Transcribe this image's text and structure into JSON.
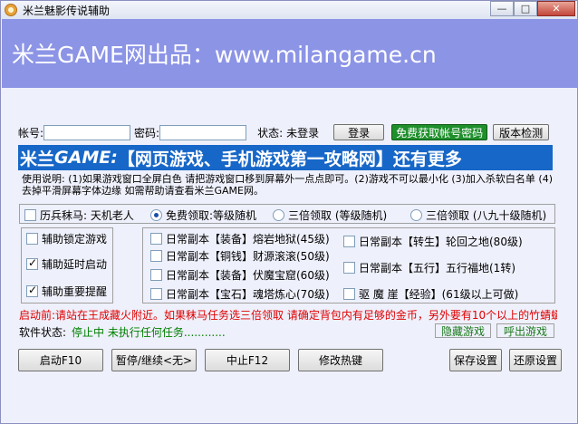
{
  "window": {
    "title": "米兰魅影传说辅助"
  },
  "title_buttons": {
    "minimize": "—",
    "maximize": "□",
    "close": "✕"
  },
  "banner": {
    "text": "米兰GAME网出品：www.milangame.cn"
  },
  "login": {
    "account_label": "帐号:",
    "account_value": "",
    "password_label": "密码:",
    "password_value": "",
    "status_label": "状态:",
    "status_value": "未登录",
    "login_button": "登录",
    "free_account_button": "免费获取帐号密码",
    "version_button": "版本检测"
  },
  "promo": {
    "prefix": "米兰",
    "game": "GAME:",
    "rest": "【网页游戏、手机游戏第一攻略网】还有更多"
  },
  "instructions": "使用说明: (1)如果游戏窗口全屏白色 请把游戏窗口移到屏幕外一点点即可。(2)游戏不可以最小化 (3)加入杀软白名单 (4)去掉平滑屏幕字体边缘 如需帮助请查看米兰GAME网。",
  "mode_options": [
    {
      "label": "历兵秣马: 天机老人",
      "type": "checkbox",
      "checked": false
    },
    {
      "label": "免费领取:等级随机",
      "type": "radio",
      "checked": true
    },
    {
      "label": "三倍领取 (等级随机)",
      "type": "radio",
      "checked": false
    },
    {
      "label": "三倍领取 (八九十级随机)",
      "type": "radio",
      "checked": false
    }
  ],
  "aux_options": [
    {
      "label": "辅助锁定游戏",
      "checked": false
    },
    {
      "label": "辅助延时启动",
      "checked": true
    },
    {
      "label": "辅助重要提醒",
      "checked": true
    }
  ],
  "daily_left": [
    {
      "label": "日常副本【装备】熔岩地狱(45级)",
      "checked": false
    },
    {
      "label": "日常副本【铜钱】财源滚滚(50级)",
      "checked": false
    },
    {
      "label": "日常副本【装备】伏魔宝窟(60级)",
      "checked": false
    },
    {
      "label": "日常副本【宝石】魂塔炼心(70级)",
      "checked": false
    }
  ],
  "daily_right": [
    {
      "label": "日常副本【转生】轮回之地(80级)",
      "checked": false
    },
    {
      "label": "日常副本【五行】五行福地(1转)",
      "checked": false
    },
    {
      "label": "驱 魔 崖【经验】(61级以上可做)",
      "checked": false
    }
  ],
  "notice": "启动前:请站在王成藏火附近。如果秣马任务选三倍领取 请确定背包内有足够的金币，另外要有10个以上的竹蜻蜓",
  "software_status": {
    "label": "软件状态:",
    "value": "停止中 未执行任何任务............"
  },
  "status_buttons": {
    "hide": "隐藏游戏",
    "show": "呼出游戏"
  },
  "bottom_buttons": {
    "start": "启动F10",
    "pause": "暂停/继续<无>",
    "stop": "中止F12",
    "hotkey": "修改热键",
    "save": "保存设置",
    "restore": "还原设置"
  },
  "colors": {
    "banner_bg": "#8c94e6",
    "promo_bg": "#1767c8",
    "window_bg": "#eef0fb",
    "notice_red": "#e00000",
    "status_green": "#008000",
    "free_button_green": "#1f8f2c"
  }
}
